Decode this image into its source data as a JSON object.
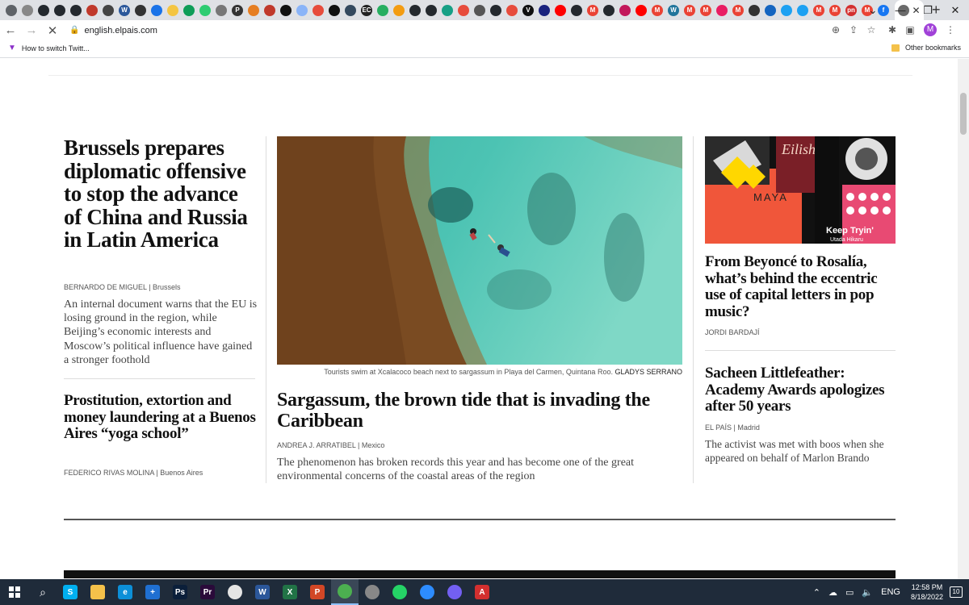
{
  "browser": {
    "url": "english.elpais.com",
    "bookmark_item": "How to switch Twitt...",
    "other_bookmarks": "Other bookmarks",
    "profile_initial": "M",
    "favicons": [
      {
        "icon": "chrome-icon",
        "color": "#5f6368",
        "glyph": ""
      },
      {
        "icon": "site-icon",
        "color": "#888888",
        "glyph": ""
      },
      {
        "icon": "github-icon",
        "color": "#24292e",
        "glyph": ""
      },
      {
        "icon": "github-icon",
        "color": "#24292e",
        "glyph": ""
      },
      {
        "icon": "github-icon",
        "color": "#24292e",
        "glyph": ""
      },
      {
        "icon": "site-icon",
        "color": "#c0392b",
        "glyph": ""
      },
      {
        "icon": "site-icon",
        "color": "#444444",
        "glyph": ""
      },
      {
        "icon": "word-icon",
        "color": "#2b579a",
        "glyph": "W"
      },
      {
        "icon": "site-icon",
        "color": "#333333",
        "glyph": ""
      },
      {
        "icon": "site-icon",
        "color": "#1a73e8",
        "glyph": ""
      },
      {
        "icon": "sticky-icon",
        "color": "#f4c542",
        "glyph": ""
      },
      {
        "icon": "site-icon",
        "color": "#0f9d58",
        "glyph": ""
      },
      {
        "icon": "site-icon",
        "color": "#2ecc71",
        "glyph": ""
      },
      {
        "icon": "site-icon",
        "color": "#777777",
        "glyph": ""
      },
      {
        "icon": "site-icon",
        "color": "#333333",
        "glyph": "P"
      },
      {
        "icon": "site-icon",
        "color": "#e67e22",
        "glyph": ""
      },
      {
        "icon": "site-icon",
        "color": "#c0392b",
        "glyph": ""
      },
      {
        "icon": "site-icon",
        "color": "#111111",
        "glyph": ""
      },
      {
        "icon": "site-icon",
        "color": "#8ab4f8",
        "glyph": ""
      },
      {
        "icon": "site-icon",
        "color": "#e74c3c",
        "glyph": ""
      },
      {
        "icon": "site-icon",
        "color": "#111111",
        "glyph": ""
      },
      {
        "icon": "site-icon",
        "color": "#34495e",
        "glyph": ""
      },
      {
        "icon": "site-icon",
        "color": "#222222",
        "glyph": "EC"
      },
      {
        "icon": "site-icon",
        "color": "#27ae60",
        "glyph": ""
      },
      {
        "icon": "site-icon",
        "color": "#f39c12",
        "glyph": ""
      },
      {
        "icon": "github-icon",
        "color": "#24292e",
        "glyph": ""
      },
      {
        "icon": "github-icon",
        "color": "#24292e",
        "glyph": ""
      },
      {
        "icon": "site-icon",
        "color": "#16a085",
        "glyph": ""
      },
      {
        "icon": "site-icon",
        "color": "#e74c3c",
        "glyph": ""
      },
      {
        "icon": "site-icon",
        "color": "#555555",
        "glyph": ""
      },
      {
        "icon": "github-icon",
        "color": "#24292e",
        "glyph": ""
      },
      {
        "icon": "site-icon",
        "color": "#e74c3c",
        "glyph": ""
      },
      {
        "icon": "site-icon",
        "color": "#111111",
        "glyph": "V"
      },
      {
        "icon": "site-icon",
        "color": "#1a237e",
        "glyph": ""
      },
      {
        "icon": "youtube-icon",
        "color": "#ff0000",
        "glyph": ""
      },
      {
        "icon": "github-icon",
        "color": "#24292e",
        "glyph": ""
      },
      {
        "icon": "gmail-icon",
        "color": "#ea4335",
        "glyph": "M"
      },
      {
        "icon": "github-icon",
        "color": "#24292e",
        "glyph": ""
      },
      {
        "icon": "site-icon",
        "color": "#c2185b",
        "glyph": ""
      },
      {
        "icon": "youtube-icon",
        "color": "#ff0000",
        "glyph": ""
      },
      {
        "icon": "gmail-icon",
        "color": "#ea4335",
        "glyph": "M"
      },
      {
        "icon": "wordpress-icon",
        "color": "#21759b",
        "glyph": "W"
      },
      {
        "icon": "gmail-icon",
        "color": "#ea4335",
        "glyph": "M"
      },
      {
        "icon": "gmail-icon",
        "color": "#ea4335",
        "glyph": "M"
      },
      {
        "icon": "site-icon",
        "color": "#e91e63",
        "glyph": ""
      },
      {
        "icon": "gmail-icon",
        "color": "#ea4335",
        "glyph": "M"
      },
      {
        "icon": "site-icon",
        "color": "#333333",
        "glyph": ""
      },
      {
        "icon": "site-icon",
        "color": "#1565c0",
        "glyph": ""
      },
      {
        "icon": "site-icon",
        "color": "#1da1f2",
        "glyph": ""
      },
      {
        "icon": "twitter-icon",
        "color": "#1da1f2",
        "glyph": ""
      },
      {
        "icon": "gmail-icon",
        "color": "#ea4335",
        "glyph": "M"
      },
      {
        "icon": "gmail-icon",
        "color": "#ea4335",
        "glyph": "M"
      },
      {
        "icon": "site-icon",
        "color": "#d32f2f",
        "glyph": "pn"
      },
      {
        "icon": "gmail-icon",
        "color": "#ea4335",
        "glyph": "M"
      },
      {
        "icon": "facebook-icon",
        "color": "#1877f2",
        "glyph": "f"
      }
    ]
  },
  "articles": {
    "lead_left": {
      "headline": "Brussels prepares diplomatic offensive to stop the advance of China and Russia in Latin America",
      "author": "BERNARDO DE MIGUEL",
      "location": "Brussels",
      "deck": "An internal document warns that the EU is losing ground in the region, while Beijing’s economic interests and Moscow’s political influence have gained a stronger foothold"
    },
    "second_left": {
      "headline": "Prostitution, extortion and money laundering at a Buenos Aires “yoga school”",
      "author": "FEDERICO RIVAS MOLINA",
      "location": "Buenos Aires"
    },
    "center": {
      "caption": "Tourists swim at Xcalacoco beach next to sargassum in Playa del Carmen, Quintana Roo.",
      "photo_credit": "GLADYS SERRANO",
      "headline": "Sargassum, the brown tide that is invading the Caribbean",
      "author": "ANDREA J. ARRATIBEL",
      "location": "Mexico",
      "deck": "The phenomenon has broken records this year and has become one of the great environmental concerns of the coastal areas of the region"
    },
    "right_top": {
      "headline": "From Beyoncé to Rosalía, what’s behind the eccentric use of capital letters in pop music?",
      "author": "JORDI BARDAJÍ",
      "artwork_text": [
        "Eilish",
        "MAYA",
        "Keep Tryin'",
        "Utada Hikaru"
      ]
    },
    "right_bottom": {
      "headline": "Sacheen Littlefeather: Academy Awards apologizes after 50 years",
      "author": "EL PAÍS",
      "location": "Madrid",
      "deck": "The activist was met with boos when she appeared on behalf of Marlon Brando"
    }
  },
  "taskbar": {
    "language": "ENG",
    "time": "12:58 PM",
    "date": "8/18/2022",
    "notifications": "10",
    "apps": [
      {
        "name": "skype-icon",
        "color": "#00aff0",
        "glyph": "S"
      },
      {
        "name": "file-explorer-icon",
        "color": "#f4c14a",
        "glyph": ""
      },
      {
        "name": "edge-icon",
        "color": "#0c8fd8",
        "glyph": "e"
      },
      {
        "name": "store-icon",
        "color": "#1f6fd1",
        "glyph": "+"
      },
      {
        "name": "photoshop-icon",
        "color": "#0b1f3a",
        "glyph": "Ps"
      },
      {
        "name": "premiere-icon",
        "color": "#2a0a3a",
        "glyph": "Pr"
      },
      {
        "name": "paint-icon",
        "color": "#e5e5e5",
        "glyph": ""
      },
      {
        "name": "word-icon",
        "color": "#2b579a",
        "glyph": "W"
      },
      {
        "name": "excel-icon",
        "color": "#217346",
        "glyph": "X"
      },
      {
        "name": "powerpoint-icon",
        "color": "#d24726",
        "glyph": "P"
      },
      {
        "name": "chrome-icon",
        "color": "#4caf50",
        "glyph": ""
      },
      {
        "name": "gimp-icon",
        "color": "#888888",
        "glyph": ""
      },
      {
        "name": "whatsapp-icon",
        "color": "#25d366",
        "glyph": ""
      },
      {
        "name": "zoom-icon",
        "color": "#2d8cff",
        "glyph": ""
      },
      {
        "name": "viber-icon",
        "color": "#7360f2",
        "glyph": ""
      },
      {
        "name": "acrobat-icon",
        "color": "#d32f2f",
        "glyph": "A"
      }
    ]
  }
}
